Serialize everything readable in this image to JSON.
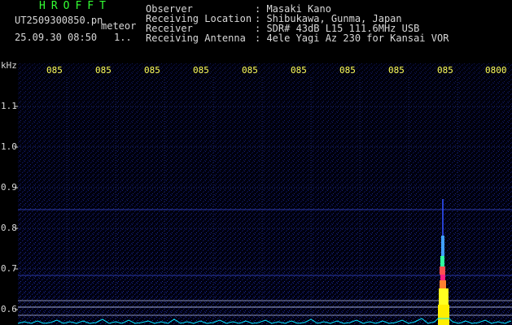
{
  "header": {
    "brand": "HROFFT",
    "filename": "UT2509300850.pn",
    "tag": "meteor",
    "datetime": "25.09.30 08:50",
    "counter": "1.."
  },
  "info": {
    "labels": [
      "Observer",
      "Receiving Location",
      "Receiver",
      "Receiving Antenna"
    ],
    "values": [
      ": Masaki Kano",
      ": Shibukawa, Gunma, Japan",
      ": SDR# 43dB L15 111.6MHz USB",
      ": 4ele Yagi Az 230 for Kansai VOR"
    ]
  },
  "axis": {
    "y_unit": "kHz",
    "y_ticks": [
      "1.1",
      "1.0",
      "0.9",
      "0.8",
      "0.7",
      "0.6"
    ],
    "x_ticks": [
      "085",
      "085",
      "085",
      "085",
      "085",
      "085",
      "085",
      "085",
      "085",
      "0800"
    ]
  },
  "colors": {
    "background": "#000000",
    "noise": "#0a1260",
    "accent": "#ffff55",
    "brand": "#33ff33",
    "trace": "#00e5ff"
  }
}
